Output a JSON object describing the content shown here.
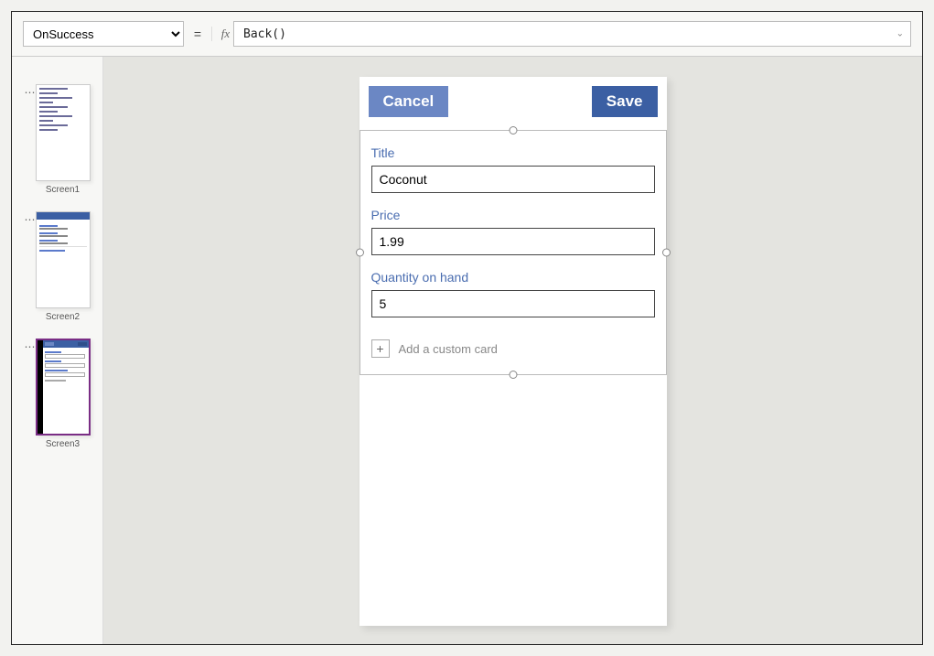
{
  "formula_bar": {
    "property": "OnSuccess",
    "equals": "=",
    "fx": "fx",
    "formula": "Back()"
  },
  "thumbnails": [
    {
      "label": "Screen1"
    },
    {
      "label": "Screen2"
    },
    {
      "label": "Screen3"
    }
  ],
  "phone": {
    "cancel": "Cancel",
    "save": "Save",
    "fields": {
      "title_label": "Title",
      "title_value": "Coconut",
      "price_label": "Price",
      "price_value": "1.99",
      "qty_label": "Quantity on hand",
      "qty_value": "5"
    },
    "add_card": "Add a custom card",
    "plus": "+"
  }
}
